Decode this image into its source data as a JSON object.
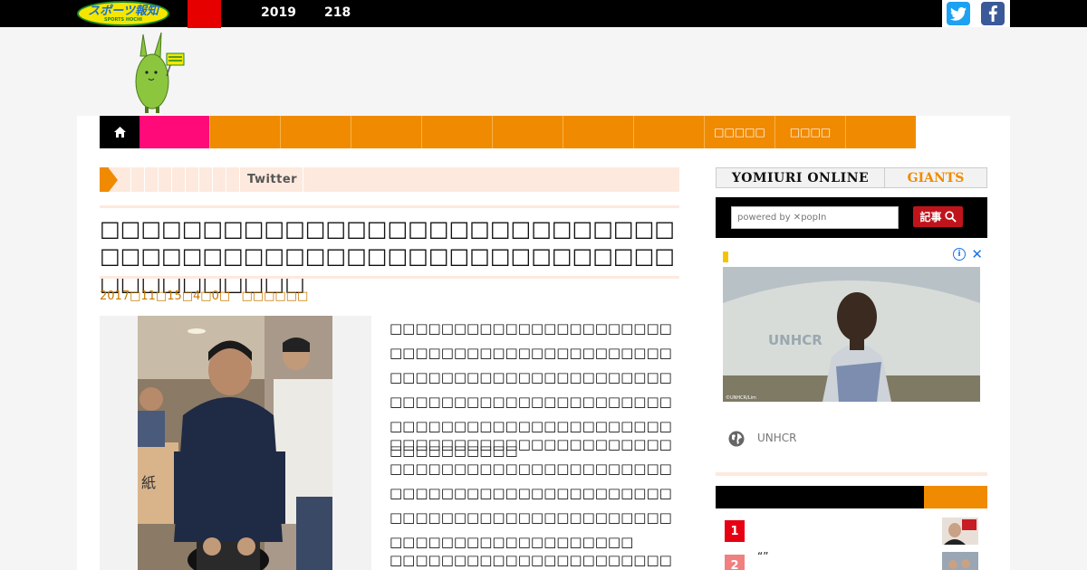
{
  "topbar": {
    "logo_main": "スポーツ報知",
    "logo_sub": "SPORTS HOCHI",
    "links": [
      "2019",
      "218"
    ],
    "social": {
      "twitter": "twitter-icon",
      "facebook": "facebook-icon"
    }
  },
  "nav": {
    "home_icon": "home-icon",
    "tabs": [
      "",
      "",
      "",
      "",
      "",
      "",
      "",
      "□□□□□",
      "□□□□",
      ""
    ]
  },
  "breadcrumb": {
    "label": "Twitter"
  },
  "article": {
    "title": "□□□□□□□□□□□□□□□□□□□□□□□□□□□□□□□□□□□□□□□□□□□□□□□□□□□□□□□□□□□□□□□□□□",
    "date": "2017□11□15□4□0□",
    "author": "□□□□□□",
    "paragraphs": [
      "□□□□□□□□□□□□□□□□□□□□□□□□□□□□□□□□□□□□□□□□□□□□□□□□□□□□□□□□□□□□□□□□□□□□□□□□□□□□□□□□□□□□□□□□□□□□□□□□□□□□□□□□□□□□□□□□□□□□□□□□",
      "□□□□□□□□□□□□□□□□□□□□□□□□□□□□□□□□□□□□□□□□□□□□□□□□□□□□□□□□□□□□□□□□□□□□□□□□□□□□□□□□□□□□□□□□□□□□□□□□□□□□□□□□□□□",
      "□□□□□□□□□□□□□□□□□□□□□□□□□□□□□□"
    ]
  },
  "sidebar": {
    "logo_left": "YOMIURI ONLINE",
    "logo_right": "GIANTS",
    "search_placeholder": "powered by ✕popIn",
    "search_button": "記事",
    "ad": {
      "advertiser": "UNHCR",
      "image_caption": "UNHCR",
      "image_credit": "©UNHCR/Lim"
    },
    "ranking": [
      {
        "num": "1",
        "title": "",
        "color": "#e60012"
      },
      {
        "num": "2",
        "title": "“”",
        "color": "#f08080"
      }
    ]
  },
  "colors": {
    "accent_orange": "#f08a00",
    "pink": "#ff0a78",
    "red": "#e60000",
    "breadcrumb_bg": "#fde9dd"
  }
}
